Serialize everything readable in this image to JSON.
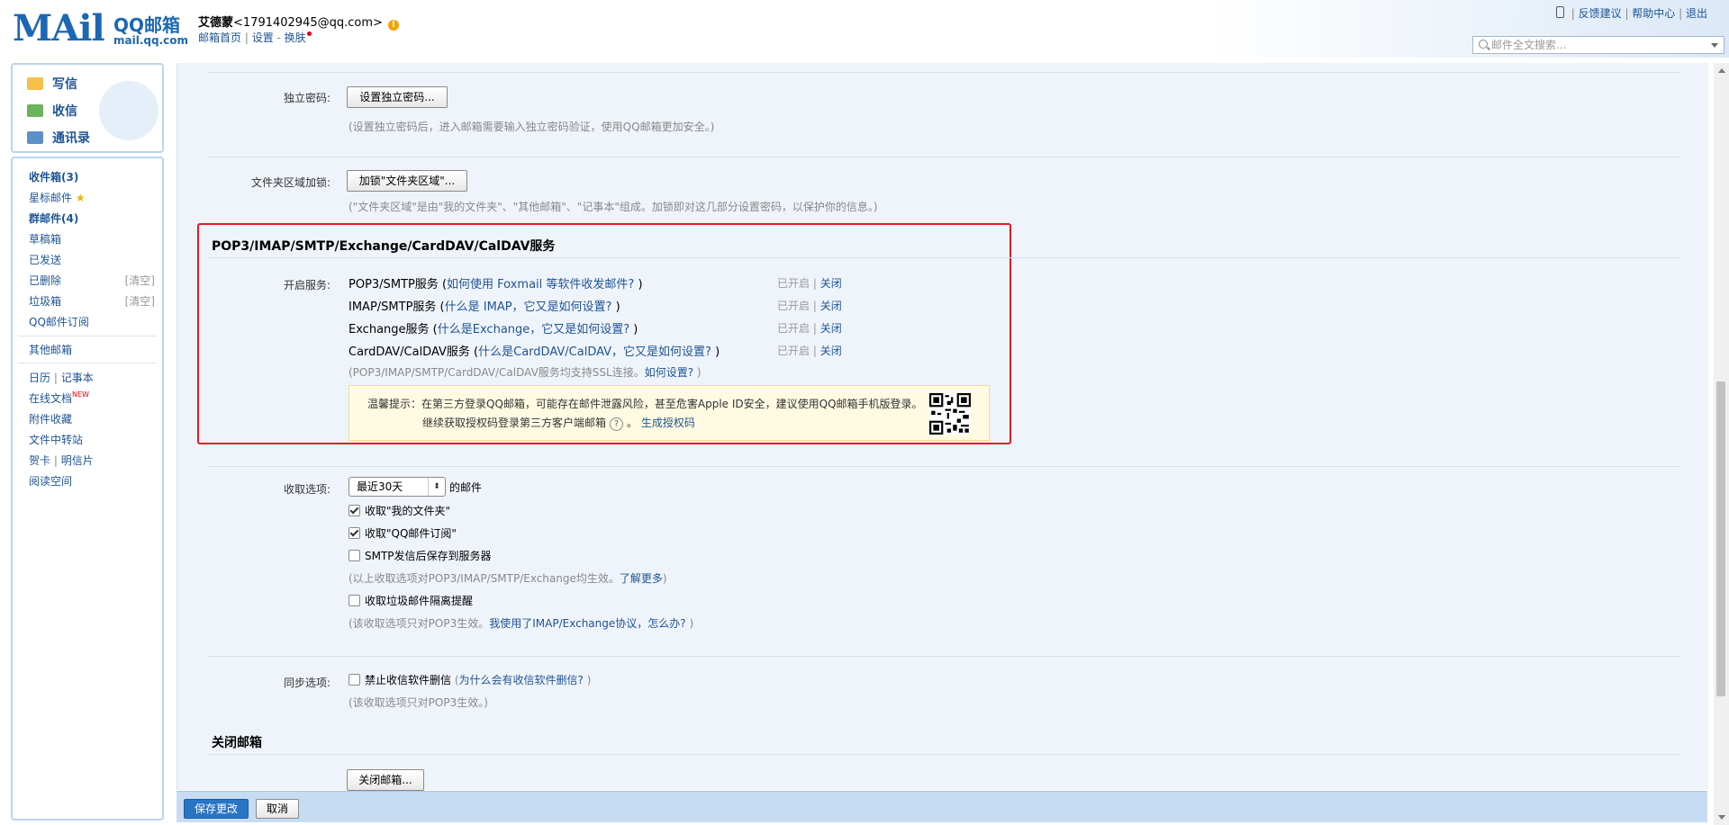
{
  "header": {
    "logo_mail": "MAil",
    "logo_name": "QQ邮箱",
    "logo_domain": "mail.qq.com",
    "user_name": "艾德蒙",
    "user_email": "<1791402945@qq.com>",
    "link_home": "邮箱首页",
    "link_settings": "设置",
    "link_skin": "换肤",
    "feedback": "反馈建议",
    "help": "帮助中心",
    "logout": "退出",
    "search_placeholder": "邮件全文搜索..."
  },
  "quick_actions": {
    "compose": "写信",
    "receive": "收信",
    "contacts": "通讯录"
  },
  "sidebar": {
    "inbox": "收件箱(3)",
    "starred": "星标邮件",
    "group": "群邮件(4)",
    "drafts": "草稿箱",
    "sent": "已发送",
    "deleted": "已删除",
    "deleted_clear": "[清空]",
    "spam": "垃圾箱",
    "spam_clear": "[清空]",
    "subscriptions": "QQ邮件订阅",
    "other_mail": "其他邮箱",
    "calendar": "日历",
    "notes": "记事本",
    "online_docs": "在线文档",
    "new_badge": "NEW",
    "attachments": "附件收藏",
    "file_transfer": "文件中转站",
    "greeting_card": "贺卡",
    "postcard": "明信片",
    "reading_space": "阅读空间"
  },
  "settings": {
    "independent_password": {
      "label": "独立密码:",
      "button": "设置独立密码...",
      "hint": "(设置独立密码后，进入邮箱需要输入独立密码验证，使用QQ邮箱更加安全。)"
    },
    "folder_lock": {
      "label": "文件夹区域加锁:",
      "button": "加锁\"文件夹区域\"...",
      "hint": "(\"文件夹区域\"是由\"我的文件夹\"、\"其他邮箱\"、\"记事本\"组成。加锁即对这几部分设置密码，以保护你的信息。)"
    },
    "services": {
      "title": "POP3/IMAP/SMTP/Exchange/CardDAV/CalDAV服务",
      "label": "开启服务:",
      "items": [
        {
          "name": "POP3/SMTP服务",
          "help": "如何使用 Foxmail 等软件收发邮件?",
          "status": "已开启",
          "action": "关闭"
        },
        {
          "name": "IMAP/SMTP服务",
          "help": "什么是 IMAP，它又是如何设置?",
          "status": "已开启",
          "action": "关闭"
        },
        {
          "name": "Exchange服务",
          "help": "什么是Exchange，它又是如何设置?",
          "status": "已开启",
          "action": "关闭"
        },
        {
          "name": "CardDAV/CalDAV服务",
          "help": "什么是CardDAV/CalDAV，它又是如何设置?",
          "status": "已开启",
          "action": "关闭"
        }
      ],
      "ssl_note": "(POP3/IMAP/SMTP/CardDAV/CalDAV服务均支持SSL连接。",
      "ssl_link": "如何设置?",
      "tip_line1": "温馨提示：在第三方登录QQ邮箱，可能存在邮件泄露风险，甚至危害Apple ID安全，建议使用QQ邮箱手机版登录。",
      "tip_line2": "继续获取授权码登录第三方客户端邮箱",
      "tip_link": "生成授权码"
    },
    "receive_options": {
      "label": "收取选项:",
      "range": "最近30天",
      "suffix": "的邮件",
      "opt_my_folders": "收取\"我的文件夹\"",
      "opt_subscriptions": "收取\"QQ邮件订阅\"",
      "opt_save_smtp": "SMTP发信后保存到服务器",
      "note1": "(以上收取选项对POP3/IMAP/SMTP/Exchange均生效。",
      "note1_link": "了解更多",
      "opt_spam": "收取垃圾邮件隔离提醒",
      "note2": "(该收取选项只对POP3生效。",
      "note2_link": "我使用了IMAP/Exchange协议，怎么办?"
    },
    "sync_options": {
      "label": "同步选项:",
      "opt_no_delete": "禁止收信软件删信",
      "link": "为什么会有收信软件删信?",
      "note": "(该收取选项只对POP3生效。)"
    },
    "close_mailbox": {
      "title": "关闭邮箱",
      "button": "关闭邮箱..."
    }
  },
  "footer": {
    "save": "保存更改",
    "cancel": "取消"
  }
}
